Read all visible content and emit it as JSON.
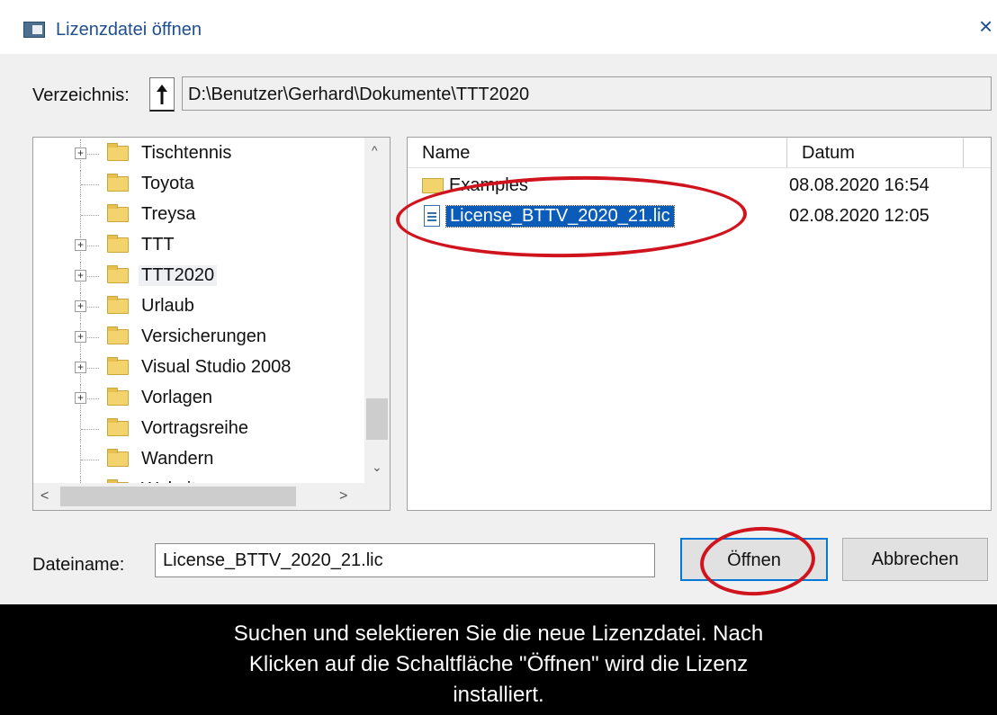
{
  "window": {
    "title": "Lizenzdatei öffnen",
    "close_glyph": "×"
  },
  "directory": {
    "label": "Verzeichnis:",
    "path": "D:\\Benutzer\\Gerhard\\Dokumente\\TTT2020"
  },
  "tree": {
    "items": [
      {
        "label": "Tischtennis",
        "expandable": true
      },
      {
        "label": "Toyota",
        "expandable": false
      },
      {
        "label": "Treysa",
        "expandable": false
      },
      {
        "label": "TTT",
        "expandable": true
      },
      {
        "label": "TTT2020",
        "expandable": true,
        "selected": true
      },
      {
        "label": "Urlaub",
        "expandable": true
      },
      {
        "label": "Versicherungen",
        "expandable": true
      },
      {
        "label": "Visual Studio 2008",
        "expandable": true
      },
      {
        "label": "Vorlagen",
        "expandable": true
      },
      {
        "label": "Vortragsreihe",
        "expandable": false
      },
      {
        "label": "Wandern",
        "expandable": false
      },
      {
        "label": "Website",
        "expandable": true
      }
    ]
  },
  "filelist": {
    "columns": {
      "name": "Name",
      "date": "Datum"
    },
    "rows": [
      {
        "name": "Examples",
        "date": "08.08.2020 16:54",
        "type": "folder"
      },
      {
        "name": "License_BTTV_2020_21.lic",
        "date": "02.08.2020 12:05",
        "type": "file",
        "selected": true
      }
    ]
  },
  "filename": {
    "label": "Dateiname:",
    "value": "License_BTTV_2020_21.lic"
  },
  "buttons": {
    "open": "Öffnen",
    "cancel": "Abbrechen"
  },
  "caption": {
    "lines": [
      "Suchen und selektieren Sie die neue Lizenzdatei. Nach",
      "Klicken auf die Schaltfläche \"Öffnen\" wird die Lizenz",
      "installiert."
    ]
  },
  "colors": {
    "selection": "#0a5cb8",
    "annotation": "#d0141e",
    "title_text": "#1f4f8f",
    "folder": "#f3d36b"
  }
}
